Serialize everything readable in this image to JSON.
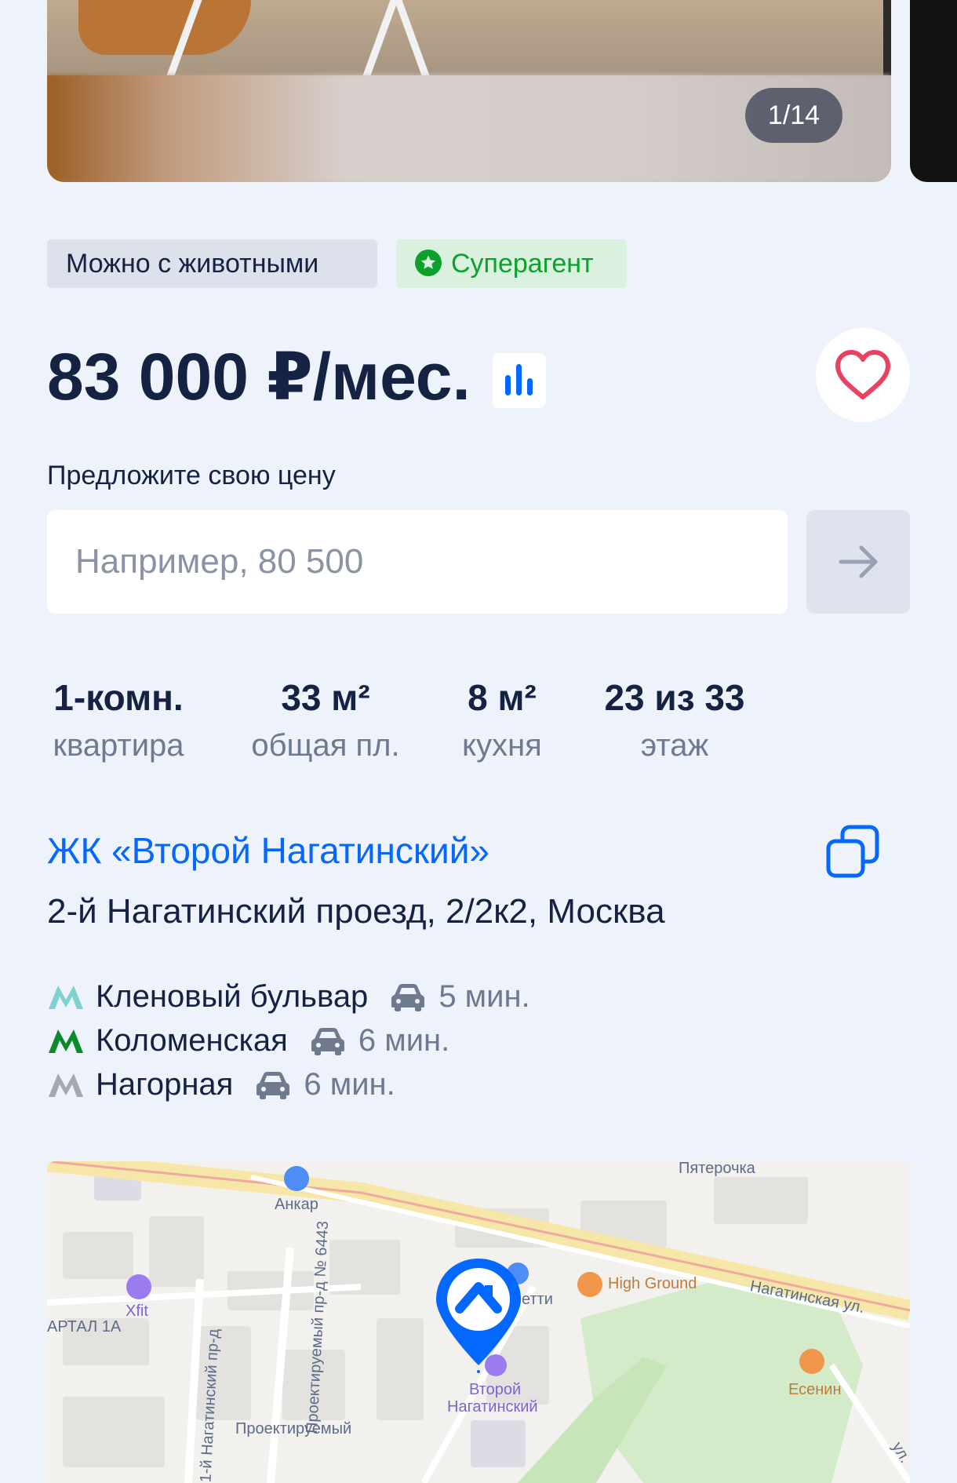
{
  "gallery": {
    "counter": "1/14"
  },
  "tags": {
    "pets": "Можно с животными",
    "superagent": "Суперагент"
  },
  "price": {
    "value": "83 000 ₽/мес."
  },
  "offer": {
    "label": "Предложите свою цену",
    "placeholder": "Например, 80 500"
  },
  "specs": [
    {
      "value": "1-комн.",
      "label": "квартира"
    },
    {
      "value": "33 м²",
      "label": "общая пл."
    },
    {
      "value": "8 м²",
      "label": "кухня"
    },
    {
      "value": "23 из 33",
      "label": "этаж"
    }
  ],
  "location": {
    "complex": "ЖК «Второй Нагатинский»",
    "address": "2-й Нагатинский проезд, 2/2к2, Москва"
  },
  "metro": [
    {
      "station": "Кленовый бульвар",
      "time": "5 мин.",
      "line_color": "#7fd1cf"
    },
    {
      "station": "Коломенская",
      "time": "6 мин.",
      "line_color": "#0a8a2b"
    },
    {
      "station": "Нагорная",
      "time": "6 мин.",
      "line_color": "#a5a8b0"
    }
  ],
  "map": {
    "labels": {
      "pyaterochka": "Пятерочка",
      "ankar": "Анкар",
      "high_ground": "High Ground",
      "nagatinskaya": "Нагатинская ул.",
      "xfit": "Xfit",
      "kvartal": "АРТАЛ 1А",
      "proezd1": "1-й Нагатинский пр-д",
      "proezd6443": "Проектируемый пр-д № 6443",
      "proektiruemy": "Проектируемый",
      "etti": "етти",
      "esenin": "Есенин",
      "vtoroy": "Второй",
      "nagatinsky": "Нагатинский",
      "ul": "ул."
    }
  },
  "colors": {
    "accent": "#0468ff",
    "text": "#152242",
    "muted": "#707a8f",
    "green": "#0ba12a",
    "favorite": "#e84260"
  }
}
